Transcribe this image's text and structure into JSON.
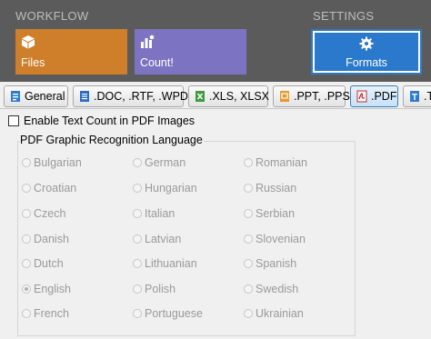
{
  "ribbon": {
    "workflow_label": "WORKFLOW",
    "settings_label": "SETTINGS",
    "files_label": "Files",
    "count_label": "Count!",
    "formats_label": "Formats"
  },
  "tabs": [
    {
      "label": "General",
      "icon": "general-icon"
    },
    {
      "label": ".DOC, .RTF, .WPD",
      "icon": "word-doc-icon"
    },
    {
      "label": ".XLS, XLSX",
      "icon": "excel-icon"
    },
    {
      "label": ".PPT, .PPS",
      "icon": "powerpoint-icon"
    },
    {
      "label": ".PDF",
      "icon": "pdf-icon",
      "active": true
    },
    {
      "label": ".T",
      "icon": "text-file-icon"
    }
  ],
  "pdf": {
    "enable_text_count_label": "Enable Text Count in PDF Images",
    "enable_text_count_checked": false,
    "group_title": "PDF Graphic Recognition Language",
    "languages": [
      [
        "Bulgarian",
        "German",
        "Romanian"
      ],
      [
        "Croatian",
        "Hungarian",
        "Russian"
      ],
      [
        "Czech",
        "Italian",
        "Serbian"
      ],
      [
        "Danish",
        "Latvian",
        "Slovenian"
      ],
      [
        "Dutch",
        "Lithuanian",
        "Spanish"
      ],
      [
        "English",
        "Polish",
        "Swedish"
      ],
      [
        "French",
        "Portuguese",
        "Ukrainian"
      ]
    ],
    "selected_language": "English"
  },
  "colors": {
    "ribbon_bg": "#5b5b5b",
    "files_tile": "#cf7f2a",
    "count_tile": "#7c74c2",
    "formats_tile": "#2b79cc"
  }
}
